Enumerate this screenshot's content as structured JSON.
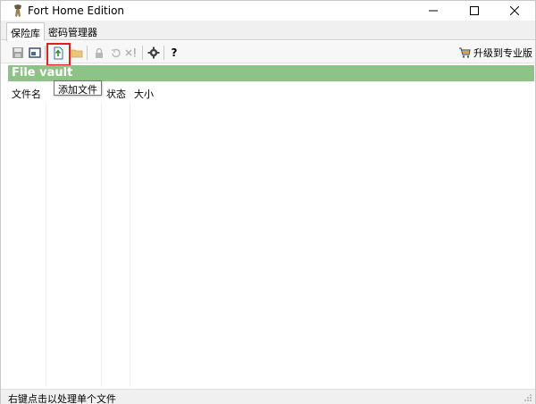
{
  "window": {
    "title": "Fort Home Edition"
  },
  "tabs": [
    {
      "label": "保险库",
      "active": true
    },
    {
      "label": "密码管理器",
      "active": false
    }
  ],
  "toolbar": {
    "upgrade_label": "升级到专业版",
    "help_label": "?",
    "tooltip": "添加文件"
  },
  "vault": {
    "title": "File vault"
  },
  "table": {
    "columns": [
      "文件名",
      "",
      "状态",
      "大小"
    ]
  },
  "status": {
    "text": "右键点击以处理单个文件"
  },
  "colors": {
    "banner": "#8ec387",
    "highlight": "#e02020"
  }
}
